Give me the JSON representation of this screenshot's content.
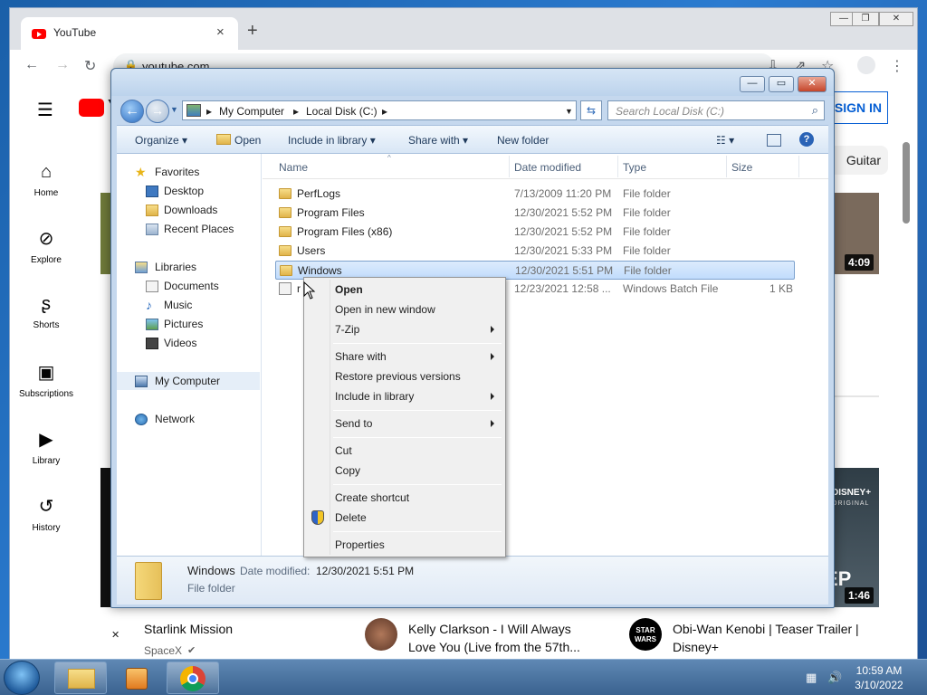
{
  "chrome": {
    "tab_title": "YouTube",
    "tab_close": "×",
    "new_tab": "+",
    "url": "youtube.com",
    "nav_back": "←",
    "nav_forward": "→",
    "nav_reload": "↻"
  },
  "youtube": {
    "logo_partial": "Y",
    "signin": "SIGN IN",
    "chip": "Guitar",
    "sidebar": [
      {
        "label": "Home",
        "icon": "home-icon"
      },
      {
        "label": "Explore",
        "icon": "explore-icon"
      },
      {
        "label": "Shorts",
        "icon": "shorts-icon"
      },
      {
        "label": "Subscriptions",
        "icon": "subscriptions-icon"
      },
      {
        "label": "Library",
        "icon": "library-icon"
      },
      {
        "label": "History",
        "icon": "history-icon"
      }
    ],
    "durations": [
      "4:09",
      "1:46"
    ],
    "partial_overlay": "EP",
    "videos": [
      {
        "title": "Starlink Mission",
        "channel": "SpaceX"
      },
      {
        "title": "Kelly Clarkson - I Will Always Love You (Live from the 57th...",
        "channel": ""
      },
      {
        "title": "Obi-Wan Kenobi | Teaser Trailer | Disney+",
        "channel": ""
      }
    ],
    "disney_badge": "DISNEY+",
    "disney_sub": "ORIGINAL",
    "starwars_badge": "STAR WARS"
  },
  "explorer": {
    "breadcrumb": [
      "My Computer",
      "Local Disk (C:)"
    ],
    "search_placeholder": "Search Local Disk (C:)",
    "commands": {
      "organize": "Organize",
      "open": "Open",
      "include_in_library": "Include in library",
      "share_with": "Share with",
      "new_folder": "New folder"
    },
    "nav": {
      "favorites": "Favorites",
      "desktop": "Desktop",
      "downloads": "Downloads",
      "recent_places": "Recent Places",
      "libraries": "Libraries",
      "documents": "Documents",
      "music": "Music",
      "pictures": "Pictures",
      "videos": "Videos",
      "my_computer": "My Computer",
      "network": "Network"
    },
    "columns": {
      "name": "Name",
      "date": "Date modified",
      "type": "Type",
      "size": "Size"
    },
    "files": [
      {
        "name": "PerfLogs",
        "date": "7/13/2009 11:20 PM",
        "type": "File folder",
        "size": ""
      },
      {
        "name": "Program Files",
        "date": "12/30/2021 5:52 PM",
        "type": "File folder",
        "size": ""
      },
      {
        "name": "Program Files (x86)",
        "date": "12/30/2021 5:52 PM",
        "type": "File folder",
        "size": ""
      },
      {
        "name": "Users",
        "date": "12/30/2021 5:33 PM",
        "type": "File folder",
        "size": ""
      },
      {
        "name": "Windows",
        "date": "12/30/2021 5:51 PM",
        "type": "File folder",
        "size": ""
      },
      {
        "name": "r",
        "date": "12/23/2021 12:58 ...",
        "type": "Windows Batch File",
        "size": "1 KB"
      }
    ],
    "details": {
      "name": "Windows",
      "date_label": "Date modified:",
      "date_value": "12/30/2021 5:51 PM",
      "type": "File folder"
    }
  },
  "context_menu": {
    "open": "Open",
    "open_new_window": "Open in new window",
    "seven_zip": "7-Zip",
    "share_with": "Share with",
    "restore_previous": "Restore previous versions",
    "include_in_library": "Include in library",
    "send_to": "Send to",
    "cut": "Cut",
    "copy": "Copy",
    "create_shortcut": "Create shortcut",
    "delete": "Delete",
    "properties": "Properties"
  },
  "taskbar": {
    "time": "10:59 AM",
    "date": "3/10/2022"
  }
}
